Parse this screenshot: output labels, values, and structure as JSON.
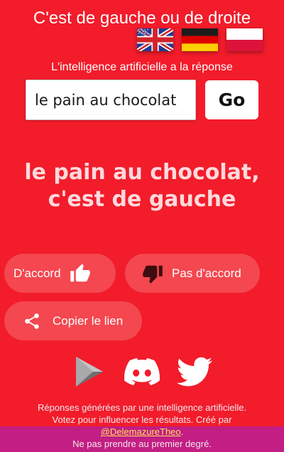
{
  "header": {
    "title": "C'est de gauche ou de droite",
    "subtitle": "L'intelligence artificielle a la réponse"
  },
  "languages": [
    "english-flag-icon",
    "german-flag-icon",
    "polish-flag-icon"
  ],
  "search": {
    "value": "le pain au chocolat",
    "go_label": "Go"
  },
  "result": {
    "line1": "le pain au chocolat,",
    "line2": "c'est de gauche"
  },
  "actions": {
    "agree_label": "D'accord",
    "disagree_label": "Pas d'accord",
    "copy_label": "Copier le lien"
  },
  "social": [
    "google-play-icon",
    "discord-icon",
    "twitter-icon"
  ],
  "footer": {
    "line1": "Réponses générées par une intelligence artificielle.",
    "line2": "Votez pour influencer les résultats. Créé par",
    "author": "@DelemazureTheo",
    "author_suffix": ".",
    "line3": "Ne pas prendre au premier degré."
  },
  "colors": {
    "background": "#f21c2b",
    "pill": "#f4474f",
    "footer_band": "#c21e84",
    "link": "#ffe05a"
  }
}
